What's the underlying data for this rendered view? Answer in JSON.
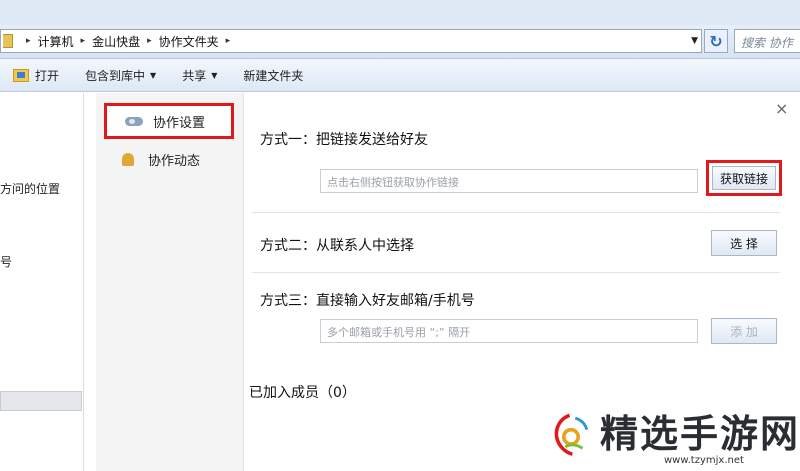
{
  "address": {
    "crumbs": [
      "计算机",
      "金山快盘",
      "协作文件夹"
    ],
    "separator": "▸",
    "search_placeholder": "搜索 协作"
  },
  "toolbar": {
    "open_label": "打开",
    "include_label": "包含到库中",
    "share_label": "共享",
    "new_folder_label": "新建文件夹"
  },
  "navpane": {
    "partial_text": "方问的位置",
    "partial_text2": "号"
  },
  "dialog": {
    "menu": {
      "settings_label": "协作设置",
      "activity_label": "协作动态"
    },
    "close_glyph": "×",
    "method1": {
      "heading": "方式一：把链接发送给好友",
      "input_placeholder": "点击右侧按钮获取协作链接",
      "button_label": "获取链接"
    },
    "method2": {
      "heading": "方式二：从联系人中选择",
      "button_label": "选 择"
    },
    "method3": {
      "heading": "方式三：直接输入好友邮箱/手机号",
      "input_placeholder": "多个邮箱或手机号用 “;” 隔开",
      "button_label": "添 加"
    },
    "members_label": "已加入成员（0）"
  },
  "watermark": {
    "name": "精选手游网",
    "url": "www.tzymjx.net"
  },
  "colors": {
    "highlight": "#e2191a",
    "toolbar_bg": "#dde8f5",
    "menu_bg": "#f4f4f4"
  }
}
